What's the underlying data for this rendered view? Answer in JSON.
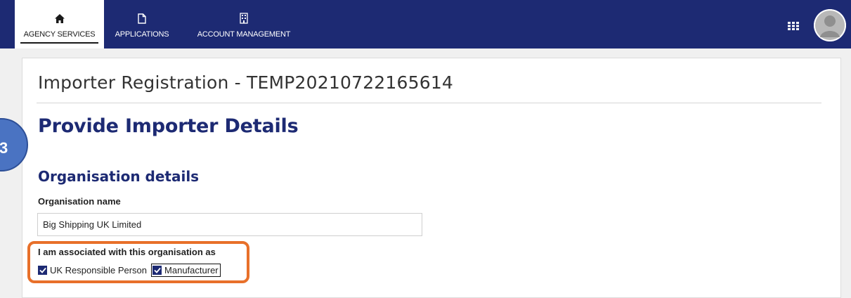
{
  "nav": {
    "tabs": [
      {
        "label": "AGENCY SERVICES",
        "icon": "home-icon",
        "active": true
      },
      {
        "label": "APPLICATIONS",
        "icon": "document-icon",
        "active": false
      },
      {
        "label": "ACCOUNT MANAGEMENT",
        "icon": "building-icon",
        "active": false
      }
    ],
    "apps_icon": "grid-icon",
    "avatar_icon": "user-avatar-icon"
  },
  "page": {
    "title": "Importer Registration - TEMP20210722165614",
    "section_title": "Provide Importer Details",
    "step_badge": "3",
    "subsection_title": "Organisation details"
  },
  "form": {
    "org_name_label": "Organisation name",
    "org_name_value": "Big Shipping UK Limited",
    "association_label": "I am associated with this organisation as",
    "options": [
      {
        "label": "UK Responsible Person",
        "checked": true
      },
      {
        "label": "Manufacturer",
        "checked": true
      }
    ]
  },
  "colors": {
    "navbar": "#1d2a73",
    "heading": "#1d2a73",
    "highlight": "#e8702a",
    "step_badge": "#4a73c2"
  }
}
